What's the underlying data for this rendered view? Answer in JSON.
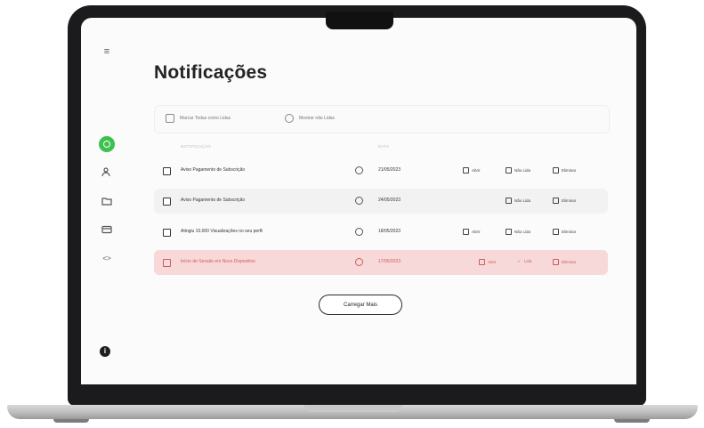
{
  "page": {
    "title": "Notificações"
  },
  "sidebar": {
    "icons": [
      "menu-icon",
      "notifications-icon",
      "users-icon",
      "folder-icon",
      "card-icon",
      "code-icon",
      "info-icon"
    ],
    "code_glyph": "<>",
    "info_glyph": "i",
    "menu_glyph": "≡"
  },
  "toolbar": {
    "mark_all_label": "Marcar Todas como Lidas",
    "show_read_label": "Mostrar não Lidas"
  },
  "table": {
    "headers": [
      "NOTIFICAÇÃO",
      "DATA"
    ],
    "rows": [
      {
        "message": "Aviso Pagamento de Subscrição",
        "date": "21/05/2023",
        "actions": [
          "Abrir",
          "Não Lida",
          "Eliminar"
        ],
        "style": "normal"
      },
      {
        "message": "Aviso Pagamento de Subscrição",
        "date": "24/05/2023",
        "actions": [
          "Não Lida",
          "Eliminar"
        ],
        "style": "alt"
      },
      {
        "message": "Atingiu 10.000 Visualizações no seu perfil",
        "date": "18/05/2023",
        "actions": [
          "Abrir",
          "Não Lida",
          "Eliminar"
        ],
        "style": "normal"
      },
      {
        "message": "Início de Sessão em Novo Dispositivo",
        "date": "17/05/2023",
        "actions": [
          "Abrir",
          "Lida",
          "Eliminar"
        ],
        "style": "error"
      }
    ]
  },
  "load_more_label": "Carregar Mais",
  "colors": {
    "accent_green": "#3ec04f",
    "error_bg": "#f7d9d9",
    "error_text": "#d05a5a"
  }
}
